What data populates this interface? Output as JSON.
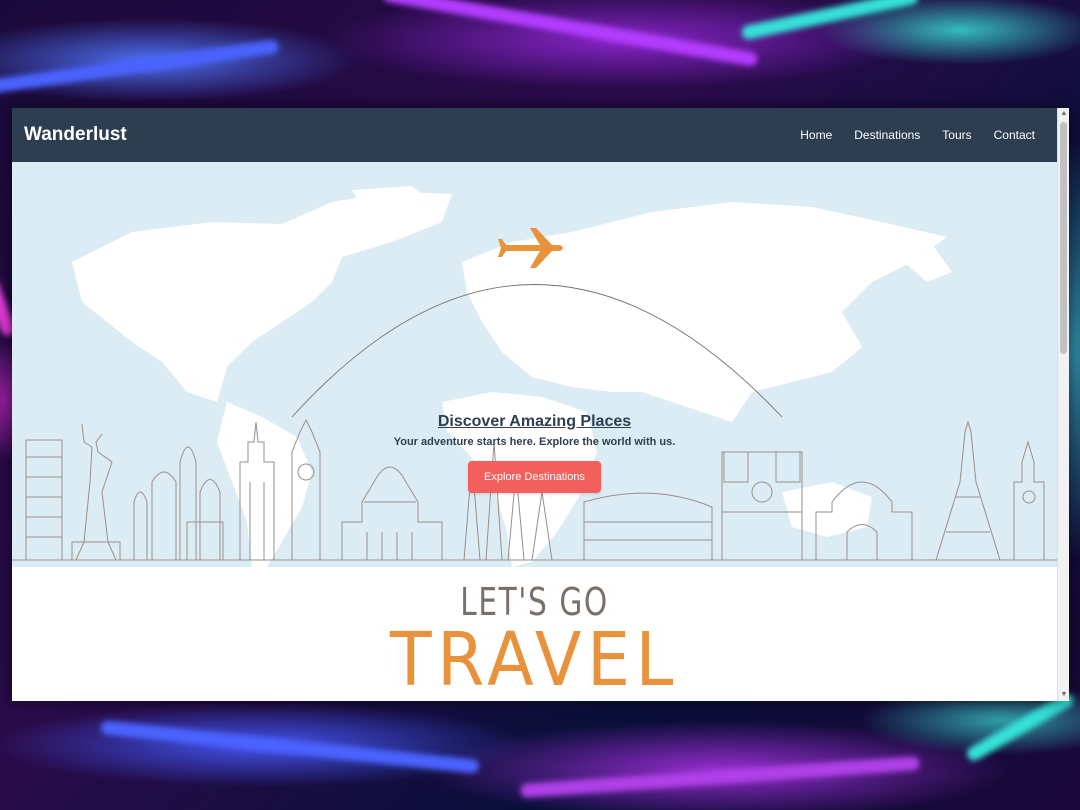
{
  "site": {
    "brand": "Wanderlust"
  },
  "nav": {
    "items": [
      "Home",
      "Destinations",
      "Tours",
      "Contact"
    ]
  },
  "hero": {
    "title": "Discover Amazing Places",
    "subtitle": "Your adventure starts here. Explore the world with us.",
    "cta_label": "Explore Destinations"
  },
  "banner": {
    "line1": "LET'S GO",
    "line2": "TRAVEL"
  },
  "colors": {
    "navbar": "#2c3e50",
    "cta": "#f25f5c",
    "accent_orange": "#e8923c",
    "map_sky": "#dcecf4"
  },
  "icons": {
    "plane": "airplane-icon",
    "scroll_up": "arrow-up-icon",
    "scroll_down": "arrow-down-icon"
  }
}
